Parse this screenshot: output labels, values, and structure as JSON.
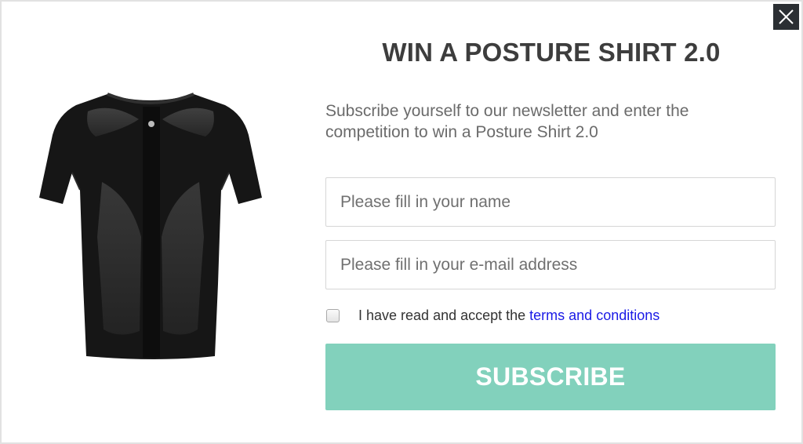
{
  "popup": {
    "title": "WIN A POSTURE SHIRT 2.0",
    "subtitle_line1": "Subscribe yourself to our newsletter and enter the",
    "subtitle_line2": "competition to win a Posture Shirt 2.0",
    "name_placeholder": "Please fill in your name",
    "name_value": "",
    "email_placeholder": "Please fill in your e-mail address",
    "email_value": "",
    "terms_checked": false,
    "terms_text": "I have read and accept the",
    "terms_link": "terms and conditions",
    "subscribe_label": "SUBSCRIBE",
    "close_icon": "close-icon",
    "product_image": "black posture shirt, back view"
  },
  "colors": {
    "subscribe_bg": "#82d1bc",
    "link": "#1a1ae6",
    "close_bg": "#2b2f33",
    "title": "#3d3d3d"
  }
}
